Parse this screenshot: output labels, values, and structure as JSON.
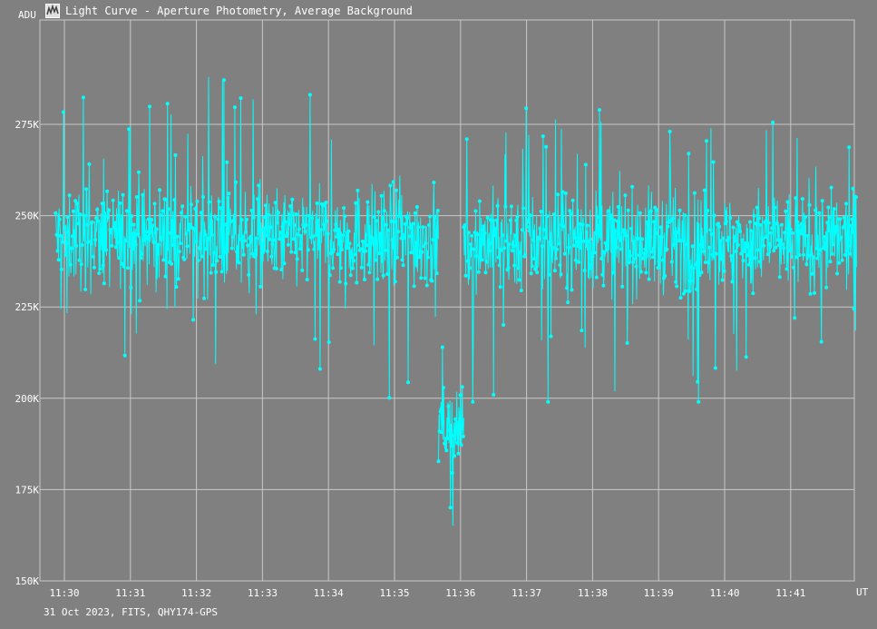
{
  "window": {
    "title": "Light Curve - Aperture Photometry, Average Background"
  },
  "footer": {
    "caption": "31 Oct 2023, FITS, QHY174-GPS"
  },
  "icon": "chart-window-icon",
  "chart_data": {
    "type": "line",
    "ylabel": "ADU",
    "xlabel": "UT",
    "x_ticks": [
      "11:30",
      "11:31",
      "11:32",
      "11:33",
      "11:34",
      "11:35",
      "11:36",
      "11:37",
      "11:38",
      "11:39",
      "11:40",
      "11:41"
    ],
    "y_ticks": [
      "150K",
      "175K",
      "200K",
      "225K",
      "250K",
      "275K"
    ],
    "ylim": [
      150000,
      275000
    ],
    "xlim_minutes": [
      -0.2,
      12.0
    ],
    "grid": true,
    "marker": "circle",
    "colors": {
      "series": "#00ffff",
      "grid": "#c8c8c8",
      "background": "#808080"
    },
    "series": [
      {
        "segments": [
          {
            "x_start": "11:29:52",
            "x_end": "11:35:40",
            "baseline": 244000,
            "scatter": 12000,
            "min": 198000,
            "max": 288000
          },
          {
            "x_start": "11:35:40",
            "x_end": "11:36:03",
            "baseline": 192000,
            "scatter": 9000,
            "min": 161000,
            "max": 214000
          },
          {
            "x_start": "11:36:03",
            "x_end": "11:42:00",
            "baseline": 243000,
            "scatter": 12000,
            "min": 199000,
            "max": 289000
          }
        ]
      }
    ]
  }
}
